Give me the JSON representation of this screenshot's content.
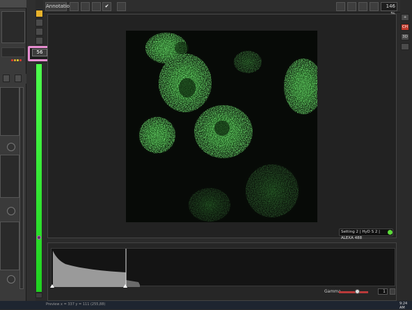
{
  "toolbar": {
    "annotations_label": "Annotations",
    "zoom_value": "146 %"
  },
  "tools": {
    "highlighted_value": "56"
  },
  "viewer": {
    "setting_text": "Setting 2 | HyD S 2 | ALEXA 488"
  },
  "histogram": {
    "gamma_label": "Gamma",
    "gamma_value": "1"
  },
  "right_panel": {
    "ch_label": "CH",
    "three_d_label": "3D"
  },
  "taskbar": {
    "status": "Preview   x = 337 y = 111   (255,88)",
    "time": "9:24 AM"
  },
  "colors": {
    "signal_green": "#39d639",
    "accent_red": "#c0392b",
    "highlight_pink": "#e88fd2"
  }
}
